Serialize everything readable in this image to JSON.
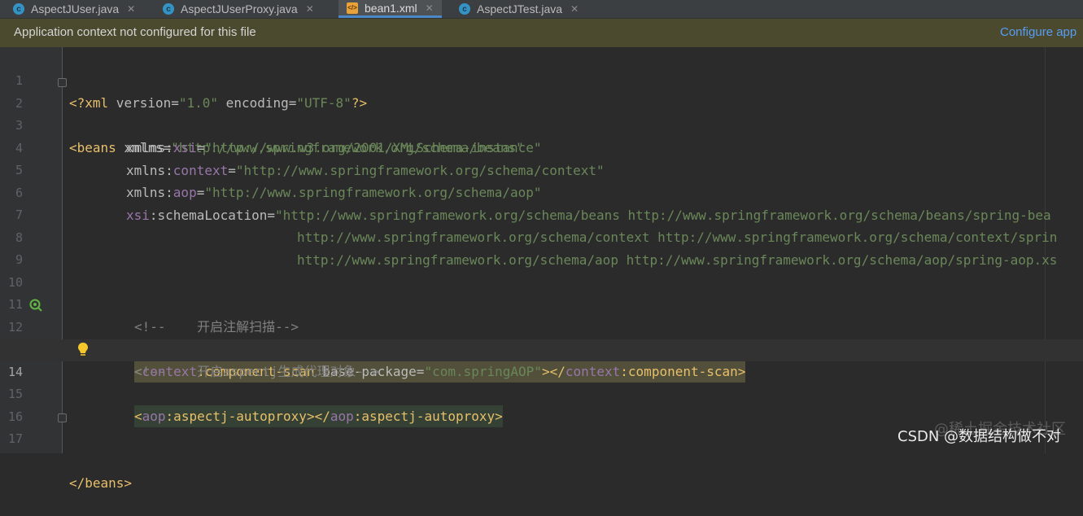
{
  "tabs": [
    {
      "label": "AspectJUser.java",
      "icon": "java-class-icon",
      "active": false
    },
    {
      "label": "AspectJUserProxy.java",
      "icon": "java-class-icon",
      "active": false
    },
    {
      "label": "bean1.xml",
      "icon": "xml-file-icon",
      "active": true
    },
    {
      "label": "AspectJTest.java",
      "icon": "java-class-icon",
      "active": false
    }
  ],
  "banner": {
    "message": "Application context not configured for this file",
    "action": "Configure app"
  },
  "editor": {
    "current_line": 14,
    "lines": [
      {
        "num": "1",
        "t": [
          "<?xml",
          " version=",
          "\"1.0\"",
          " encoding=",
          "\"UTF-8\"",
          "?>"
        ]
      },
      {
        "num": "2",
        "t": [
          "<beans",
          " xmlns=",
          "\"http://www.springframework.org/schema/beans\""
        ]
      },
      {
        "num": "3",
        "t": [
          "xmlns:",
          "xsi",
          "=",
          "\"http://www.w3.org/2001/XMLSchema-instance\""
        ]
      },
      {
        "num": "4",
        "t": [
          "xmlns:",
          "context",
          "=",
          "\"http://www.springframework.org/schema/context\""
        ]
      },
      {
        "num": "5",
        "t": [
          "xmlns:",
          "aop",
          "=",
          "\"http://www.springframework.org/schema/aop\""
        ]
      },
      {
        "num": "6",
        "t": [
          "xsi",
          ":schemaLocation=",
          "\"http://www.springframework.org/schema/beans http://www.springframework.org/schema/beans/spring-bea"
        ]
      },
      {
        "num": "7",
        "t": [
          "http://www.springframework.org/schema/context http://www.springframework.org/schema/context/sprin"
        ]
      },
      {
        "num": "8",
        "t": [
          "http://www.springframework.org/schema/aop http://www.springframework.org/schema/aop/spring-aop.xs"
        ]
      },
      {
        "num": "9",
        "t": []
      },
      {
        "num": "10",
        "t": []
      },
      {
        "num": "11",
        "t": [
          "<!--    开启注解扫描-->"
        ]
      },
      {
        "num": "12",
        "t": [
          "<",
          "context",
          ":component-scan",
          " base-package=",
          "\"com.springAOP\"",
          "></",
          "context",
          ":component-scan>"
        ]
      },
      {
        "num": "13",
        "t": [
          "<!--    开启aspectj生成代理对象-->"
        ]
      },
      {
        "num": "14",
        "t": [
          "<",
          "aop",
          ":aspectj-autoproxy></",
          "aop",
          ":aspectj-autoproxy>"
        ]
      },
      {
        "num": "15",
        "t": []
      },
      {
        "num": "16",
        "t": []
      },
      {
        "num": "17",
        "t": [
          "</beans>"
        ]
      }
    ]
  },
  "watermark": {
    "shadow": "@稀土掘金技术社区",
    "text": "CSDN @数据结构做不对"
  },
  "colors": {
    "tag": "#e8bf6a",
    "namespace": "#9876aa",
    "string": "#6a8759",
    "comment": "#808080",
    "attribute": "#bababa",
    "banner_bg": "#4b4a2e",
    "link": "#589df6",
    "active_tab_underline": "#4a88c7"
  }
}
